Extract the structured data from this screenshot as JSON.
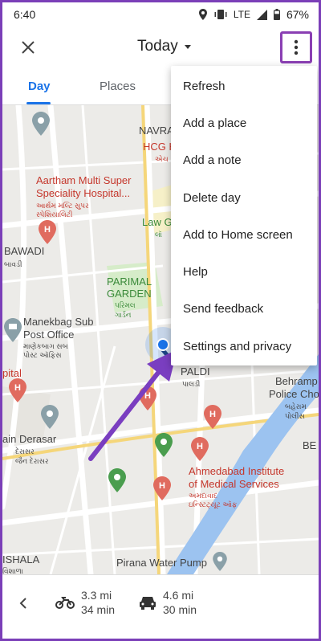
{
  "status_bar": {
    "time": "6:40",
    "network": "LTE",
    "battery": "67%"
  },
  "app_bar": {
    "date_label": "Today"
  },
  "tabs": [
    {
      "label": "Day",
      "active": true
    },
    {
      "label": "Places",
      "active": false
    }
  ],
  "menu": {
    "items": [
      "Refresh",
      "Add a place",
      "Add a note",
      "Delete day",
      "Add to Home screen",
      "Help",
      "Send feedback",
      "Settings and privacy"
    ]
  },
  "map_labels": {
    "navra": "NAVRA",
    "hcg": "HCG H",
    "hcg_local": "એચ",
    "aartham_1": "Aartham Multi Super",
    "aartham_2": "Speciality Hospital...",
    "aartham_local_1": "આર્થમ મલ્ટિ સુપર",
    "aartham_local_2": "સ્પેશિયાલિટી",
    "law_garden": "Law G",
    "law_garden_local": "લૉ",
    "bawadi": "BAWADI",
    "bawadi_local": "બાવડી",
    "parimal_1": "PARIMAL",
    "parimal_2": "GARDEN",
    "parimal_local_1": "પરિમલ",
    "parimal_local_2": "ગાર્ડન",
    "manekbag_1": "Manekbag Sub",
    "manekbag_2": "Post Office",
    "manekbag_local_1": "માણેકબાગ સબ",
    "manekbag_local_2": "પોસ્ટ ઑફિસ",
    "pital": "pital",
    "paldi": "PALDI",
    "paldi_local": "પાલડી",
    "behram_1": "Behramp",
    "behram_2": "Police Chov",
    "behram_local": "બહેરામ",
    "behram_local_2": "પોલીસ",
    "be": "BE",
    "ain_derasar": "ain Derasar",
    "derasar_local_1": "દેરાસર",
    "derasar_local_2": "જૈન દેરાસર",
    "ahmedabad_1": "Ahmedabad Institute",
    "ahmedabad_2": "of Medical Services",
    "ahmedabad_local_1": "અમદાવાદ",
    "ahmedabad_local_2": "ઇન્સ્ટિટ્યૂટ ઑફ",
    "pirana": "Pirana Water Pump",
    "shala": "ISHALA",
    "shala_local": "વિશાળા"
  },
  "trips": [
    {
      "mode_icon": "motorcycle-icon",
      "distance": "3.3 mi",
      "duration": "34 min"
    },
    {
      "mode_icon": "car-icon",
      "distance": "4.6 mi",
      "duration": "30 min"
    }
  ],
  "colors": {
    "accent_blue": "#1a73e8",
    "highlight_purple": "#7b3fb8",
    "arrow_purple": "#7a3ec0",
    "hospital_red": "#e06b5f",
    "map_green": "#4a9d4e",
    "route_blue": "#1f3a6e",
    "river_blue": "#9cc3f0"
  }
}
